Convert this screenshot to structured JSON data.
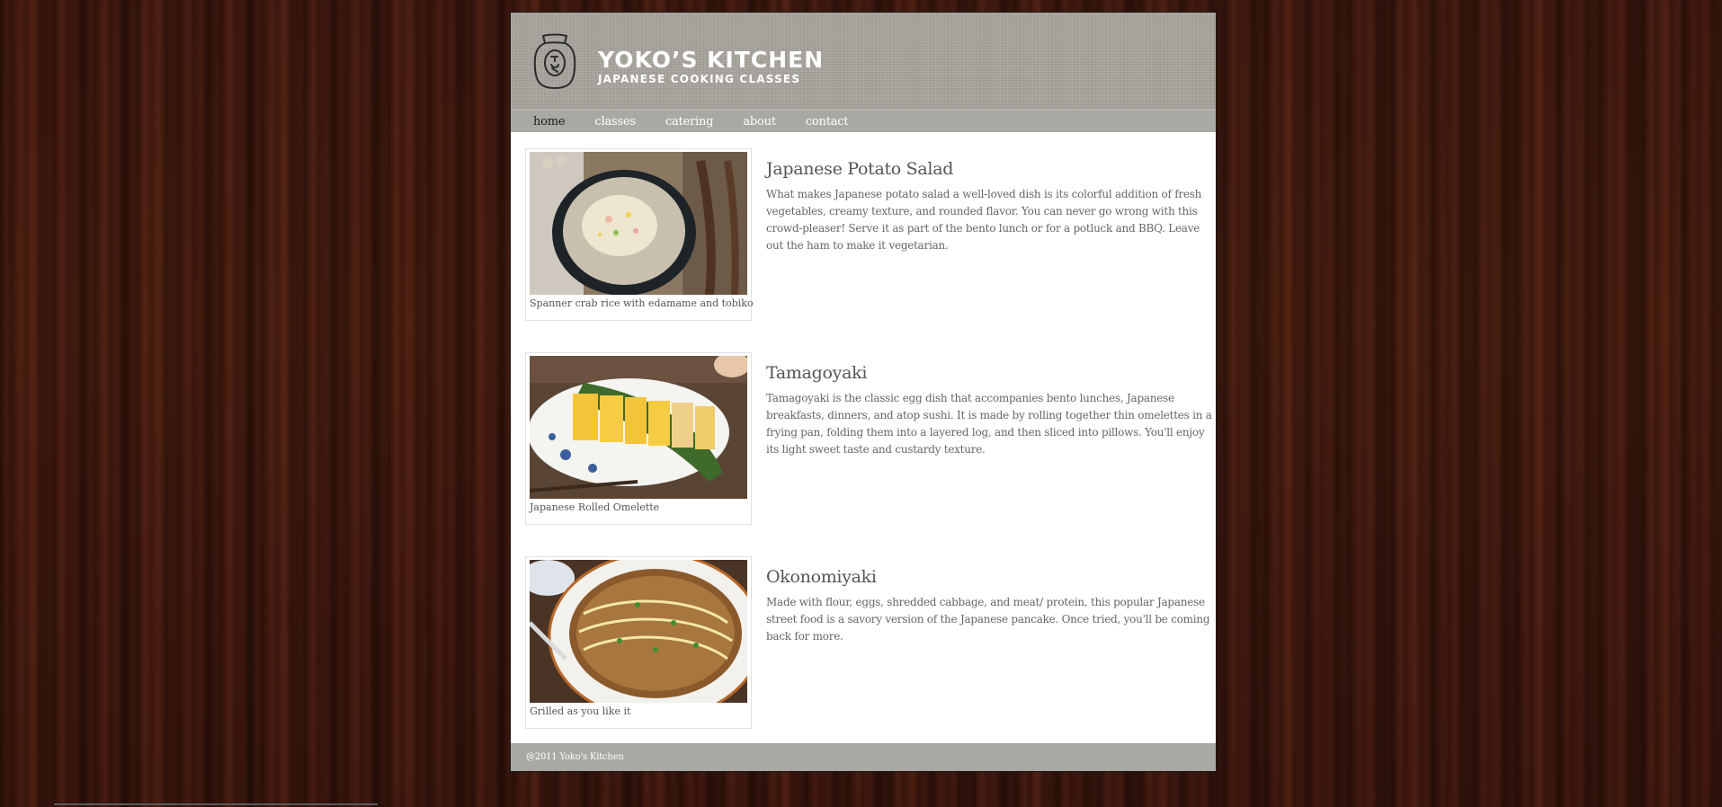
{
  "brand": {
    "title": "YOKO’S KITCHEN",
    "subtitle": "JAPANESE COOKING CLASSES",
    "logo_icon": "jar-logo-icon"
  },
  "nav": {
    "items": [
      {
        "label": "home",
        "active": true
      },
      {
        "label": "classes",
        "active": false
      },
      {
        "label": "catering",
        "active": false
      },
      {
        "label": "about",
        "active": false
      },
      {
        "label": "contact",
        "active": false
      }
    ]
  },
  "articles": [
    {
      "title": "Japanese Potato Salad",
      "caption": "Spanner crab rice with edamame and tobiko",
      "body": "What makes Japanese potato salad a well-loved dish is its colorful addition of fresh vegetables, creamy texture, and rounded flavor. You can never go wrong with this crowd-pleaser! Serve it as part of the bento lunch or for a potluck and BBQ. Leave out the ham to make it vegetarian."
    },
    {
      "title": "Tamagoyaki",
      "caption": "Japanese Rolled Omelette",
      "body": "Tamagoyaki is the classic egg dish that accompanies bento lunches, Japanese breakfasts, dinners, and atop sushi. It is made by rolling together thin omelettes in a frying pan, folding them into a layered log, and then sliced into pillows. You'll enjoy its light sweet taste and custardy texture."
    },
    {
      "title": "Okonomiyaki",
      "caption": "Grilled as you like it",
      "body": "Made with flour, eggs, shredded cabbage, and meat/ protein, this popular Japanese street food is a savory version of the Japanese pancake. Once tried, you'll be coming back for more."
    }
  ],
  "footer": {
    "text": "@2011 Yoko's Kitchen"
  },
  "colors": {
    "header_bg": "#a8a59d",
    "nav_bg": "#aaa8a2",
    "wood_bg": "#3a1810",
    "heading_text": "#555555",
    "body_text": "#666666"
  }
}
